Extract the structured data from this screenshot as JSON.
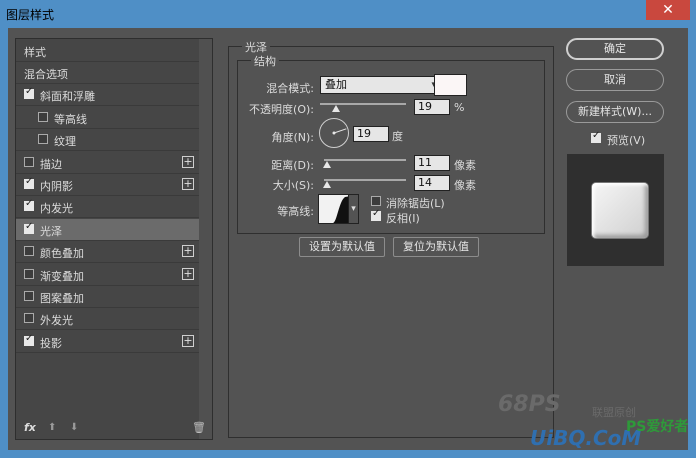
{
  "window": {
    "title": "图层样式",
    "close_glyph": "✕"
  },
  "sidebar": {
    "header": "样式",
    "items": [
      {
        "label": "混合选项",
        "checkbox": false,
        "checked": false,
        "indent": 0,
        "plus": false,
        "selected": false
      },
      {
        "label": "斜面和浮雕",
        "checkbox": true,
        "checked": true,
        "indent": 0,
        "plus": false,
        "selected": false
      },
      {
        "label": "等高线",
        "checkbox": true,
        "checked": false,
        "indent": 1,
        "plus": false,
        "selected": false
      },
      {
        "label": "纹理",
        "checkbox": true,
        "checked": false,
        "indent": 1,
        "plus": false,
        "selected": false
      },
      {
        "label": "描边",
        "checkbox": true,
        "checked": false,
        "indent": 0,
        "plus": true,
        "selected": false
      },
      {
        "label": "内阴影",
        "checkbox": true,
        "checked": true,
        "indent": 0,
        "plus": true,
        "selected": false
      },
      {
        "label": "内发光",
        "checkbox": true,
        "checked": true,
        "indent": 0,
        "plus": false,
        "selected": false
      },
      {
        "label": "光泽",
        "checkbox": true,
        "checked": true,
        "indent": 0,
        "plus": false,
        "selected": true
      },
      {
        "label": "颜色叠加",
        "checkbox": true,
        "checked": false,
        "indent": 0,
        "plus": true,
        "selected": false
      },
      {
        "label": "渐变叠加",
        "checkbox": true,
        "checked": false,
        "indent": 0,
        "plus": true,
        "selected": false
      },
      {
        "label": "图案叠加",
        "checkbox": true,
        "checked": false,
        "indent": 0,
        "plus": false,
        "selected": false
      },
      {
        "label": "外发光",
        "checkbox": true,
        "checked": false,
        "indent": 0,
        "plus": false,
        "selected": false
      },
      {
        "label": "投影",
        "checkbox": true,
        "checked": true,
        "indent": 0,
        "plus": true,
        "selected": false
      }
    ],
    "footer": {
      "fx": "fx",
      "up_glyph": "⬆",
      "down_glyph": "⬇",
      "trash_glyph": "🗑"
    }
  },
  "satin": {
    "group_title": "光泽",
    "structure_title": "结构",
    "blend_mode": {
      "label": "混合模式:",
      "value": "叠加",
      "color": "#fbf6f6"
    },
    "opacity": {
      "label": "不透明度(O):",
      "value": "19",
      "unit": "%",
      "percent": 19
    },
    "angle": {
      "label": "角度(N):",
      "value": "19",
      "unit": "度",
      "degrees": 19
    },
    "distance": {
      "label": "距离(D):",
      "value": "11",
      "unit": "像素",
      "fraction": 0.04
    },
    "size": {
      "label": "大小(S):",
      "value": "14",
      "unit": "像素",
      "fraction": 0.04
    },
    "contour": {
      "label": "等高线:"
    },
    "anti_alias": {
      "label": "消除锯齿(L)",
      "checked": false
    },
    "invert": {
      "label": "反相(I)",
      "checked": true
    },
    "make_default": "设置为默认值",
    "reset_default": "复位为默认值"
  },
  "actions": {
    "ok": "确定",
    "cancel": "取消",
    "new_style": "新建样式(W)...",
    "preview": {
      "label": "预览(V)",
      "checked": true
    }
  },
  "watermark": {
    "text_1": "68PS",
    "text_2": "联盟原创",
    "text_3": "UiBQ.CoM",
    "text_4": "PS爱好者"
  }
}
